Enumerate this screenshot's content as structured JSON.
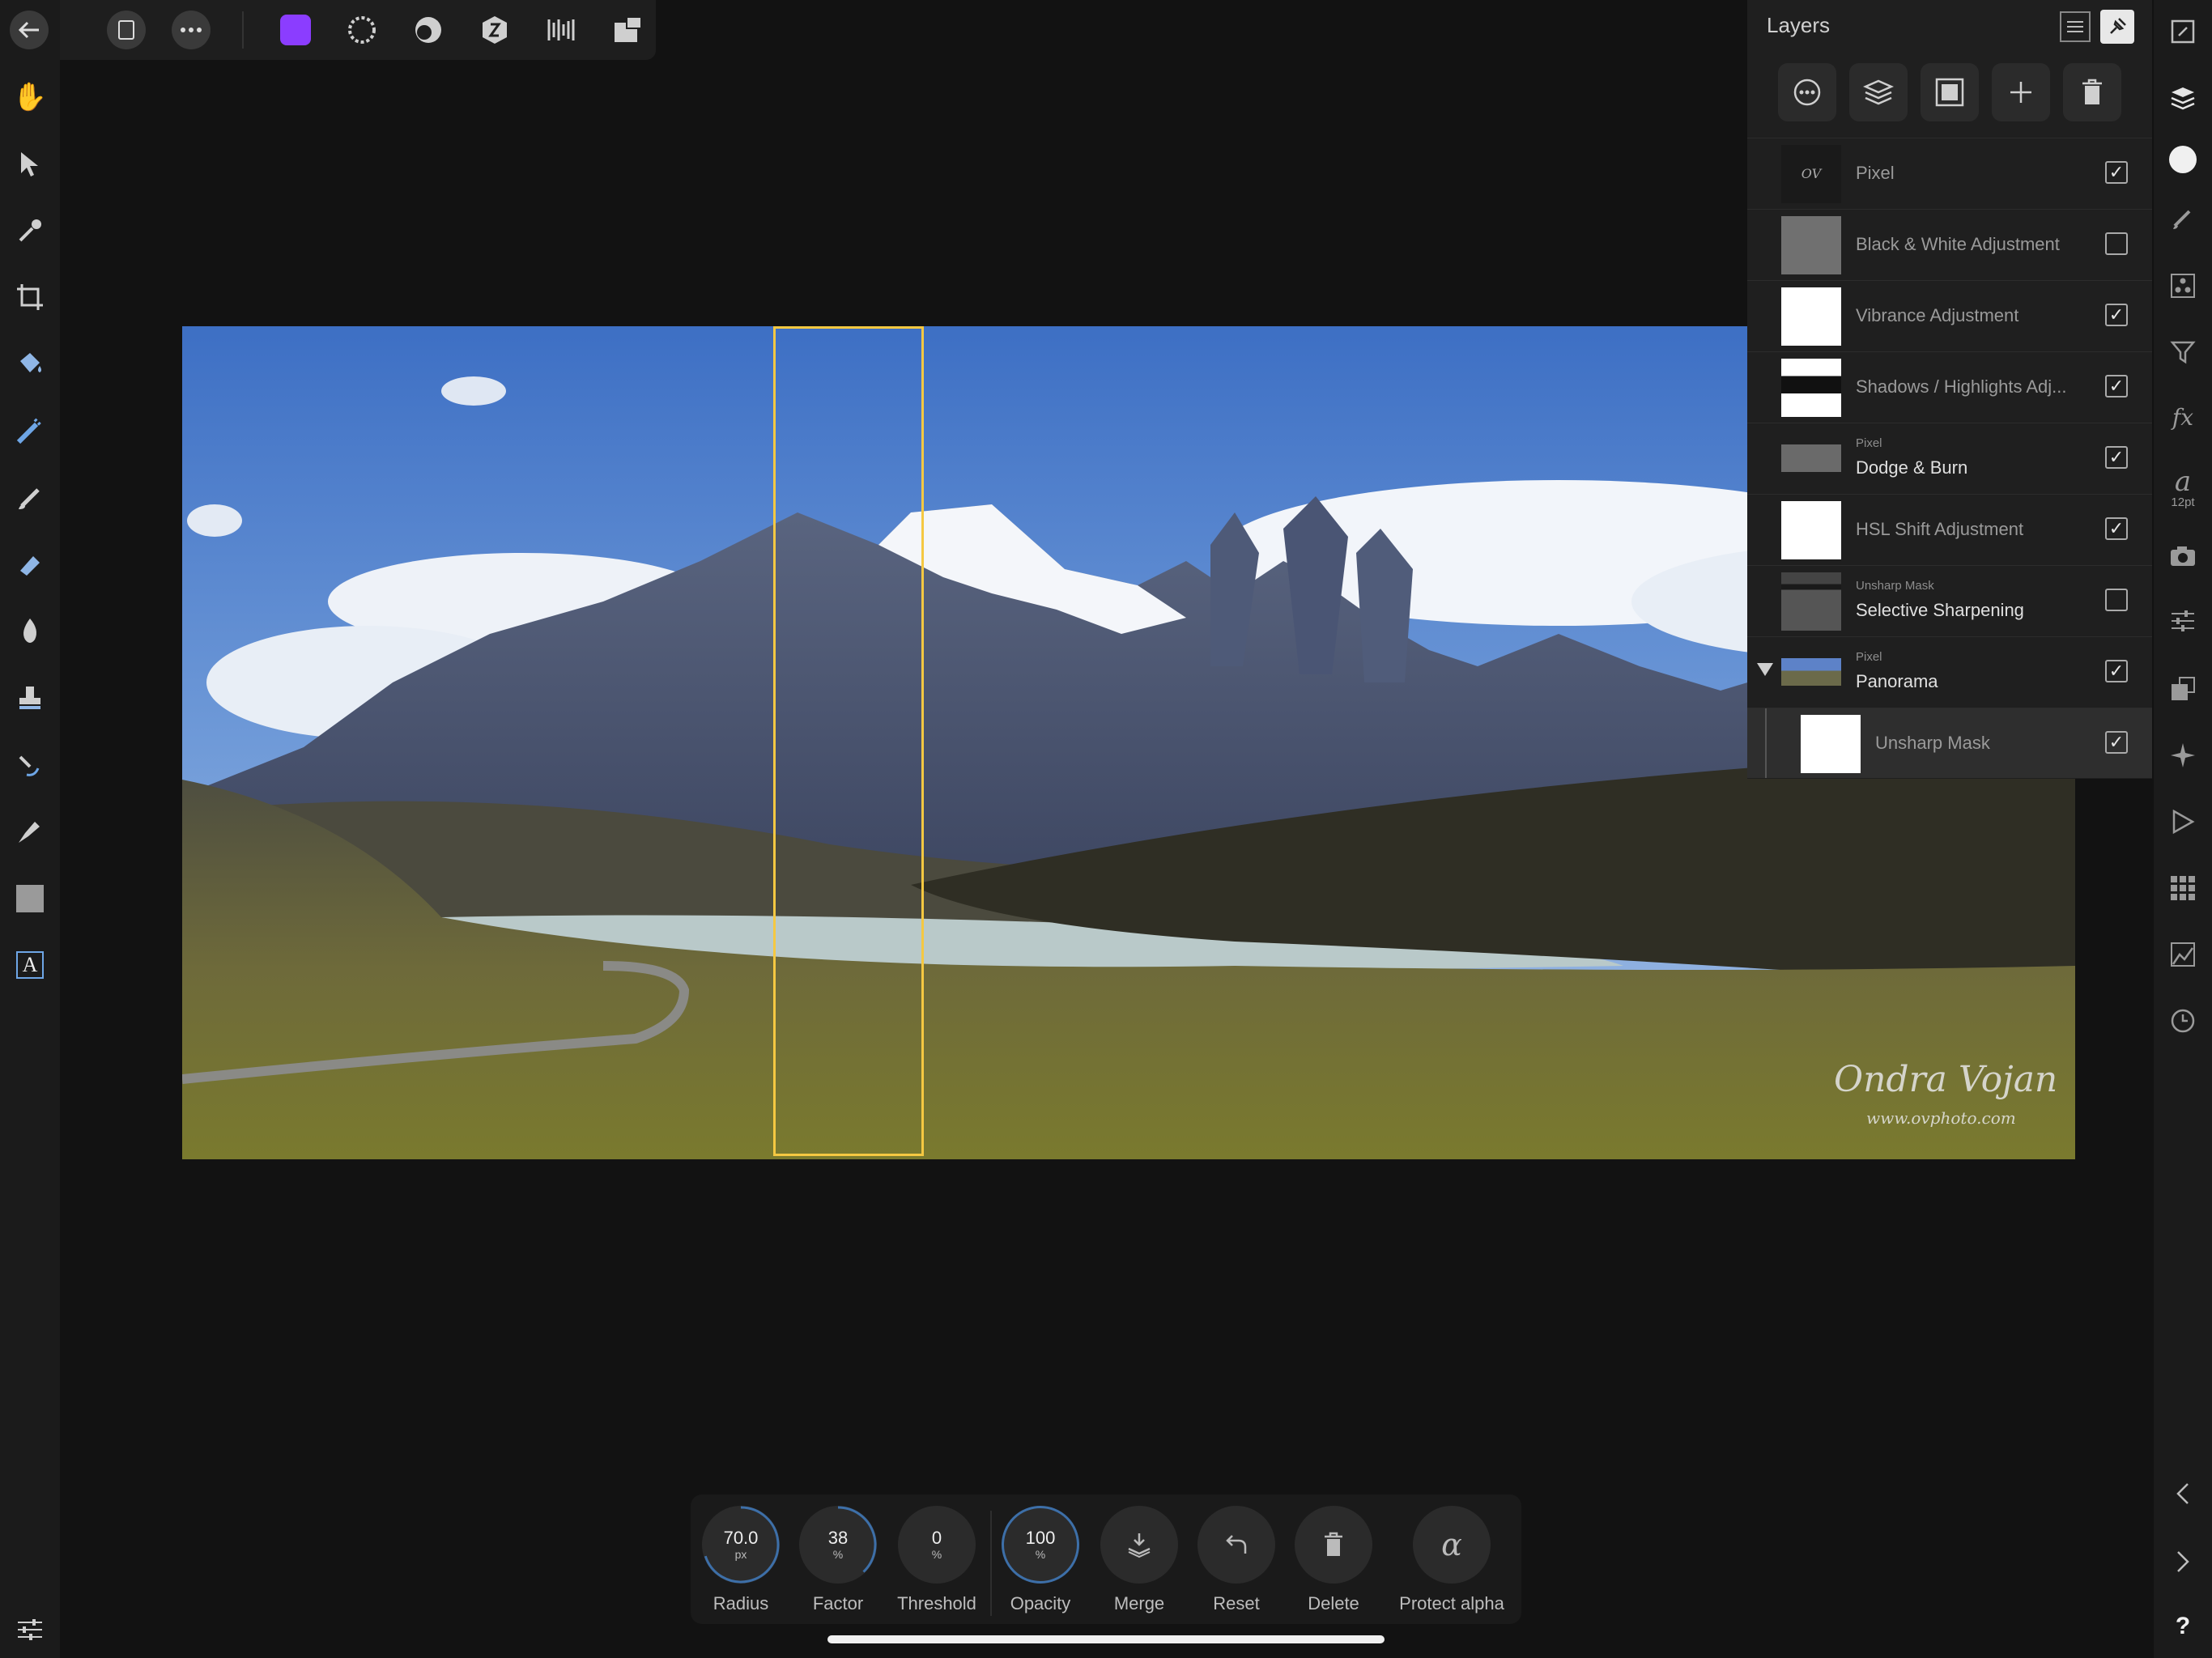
{
  "top_toolbar": {
    "icons": [
      "back-arrow-icon",
      "document-icon",
      "more-icon",
      "photo-persona-icon",
      "liquify-persona-icon",
      "develop-persona-icon",
      "tone-mapping-persona-icon",
      "export-persona-icon",
      "split-view-icon"
    ]
  },
  "tools": [
    "view-hand",
    "move",
    "color-picker",
    "crop",
    "flood-fill",
    "selection-brush",
    "paint-brush",
    "erase-brush",
    "dodge-burn",
    "clone",
    "healing",
    "pen",
    "shape",
    "text"
  ],
  "layers_panel": {
    "title": "Layers",
    "layers": [
      {
        "name": "Pixel",
        "type": "",
        "visible": true,
        "dim": true
      },
      {
        "name": "Black & White Adjustment",
        "type": "",
        "visible": false,
        "dim": true
      },
      {
        "name": "Vibrance Adjustment",
        "type": "",
        "visible": true,
        "dim": true
      },
      {
        "name": "Shadows / Highlights Adj...",
        "type": "",
        "visible": true,
        "dim": true
      },
      {
        "name": "Dodge & Burn",
        "type": "Pixel",
        "visible": true,
        "dim": false
      },
      {
        "name": "HSL Shift Adjustment",
        "type": "",
        "visible": true,
        "dim": true
      },
      {
        "name": "Selective Sharpening",
        "type": "Unsharp Mask",
        "visible": false,
        "dim": false
      },
      {
        "name": "Panorama",
        "type": "Pixel",
        "visible": true,
        "dim": false
      },
      {
        "name": "Unsharp Mask",
        "type": "",
        "visible": true,
        "dim": true
      }
    ]
  },
  "right_strip": {
    "text_size_label": "12pt"
  },
  "watermark": {
    "signature": "Ondra Vojan",
    "url": "www.ovphoto.com"
  },
  "context_toolbar": {
    "radius": {
      "value": "70.0",
      "unit": "px",
      "label": "Radius",
      "fraction": 0.7
    },
    "factor": {
      "value": "38",
      "unit": "%",
      "label": "Factor",
      "fraction": 0.38
    },
    "threshold": {
      "value": "0",
      "unit": "%",
      "label": "Threshold",
      "fraction": 0
    },
    "opacity": {
      "value": "100",
      "unit": "%",
      "label": "Opacity",
      "fraction": 1
    },
    "merge_label": "Merge",
    "reset_label": "Reset",
    "delete_label": "Delete",
    "protect_alpha_label": "Protect alpha"
  },
  "colors": {
    "selection_outline": "#f5c842",
    "accent_blue": "#3d6fa8",
    "persona_purple": "#8b3dff"
  }
}
